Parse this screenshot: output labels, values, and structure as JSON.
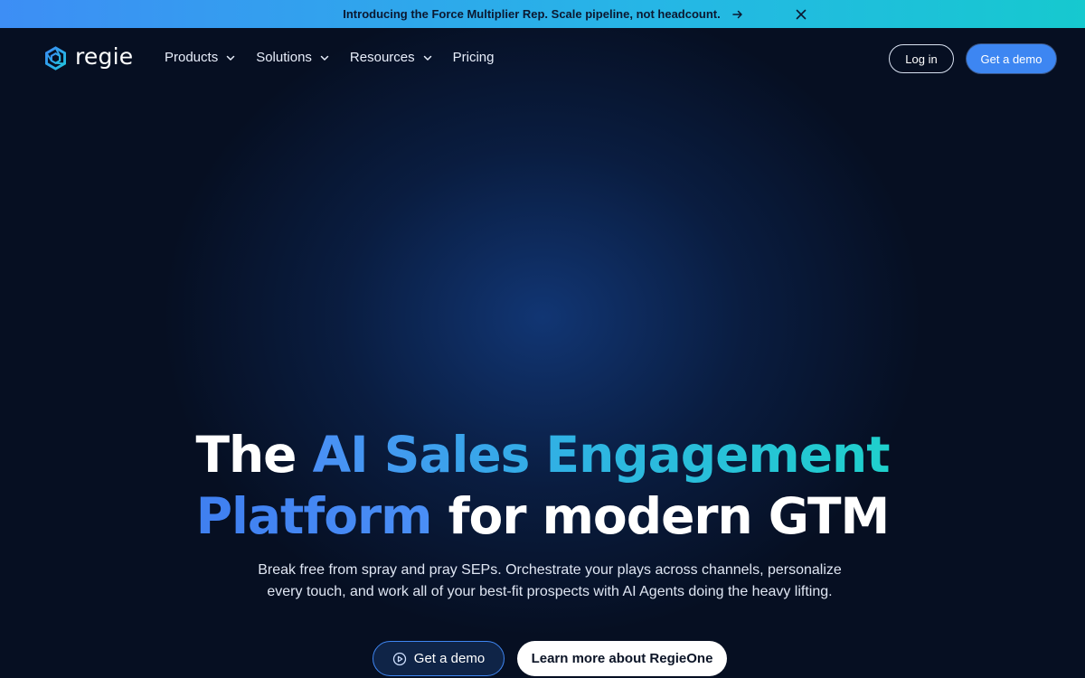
{
  "announcement": {
    "text": "Introducing the Force Multiplier Rep. Scale pipeline, not headcount.",
    "arrow_icon": "arrow-right-icon",
    "close_icon": "close-icon"
  },
  "nav": {
    "logo_text": "regie",
    "menu": [
      {
        "label": "Products",
        "has_dropdown": true
      },
      {
        "label": "Solutions",
        "has_dropdown": true
      },
      {
        "label": "Resources",
        "has_dropdown": true
      },
      {
        "label": "Pricing",
        "has_dropdown": false
      }
    ],
    "login_label": "Log in",
    "demo_label": "Get a demo"
  },
  "hero": {
    "title_part1": "The ",
    "title_gradient1": "AI Sales Engagement",
    "title_gradient2": "Platform",
    "title_part2": " for modern GTM",
    "subtitle": "Break free from spray and pray SEPs. Orchestrate your plays across channels, personalize every touch, and work all of your best-fit prospects with AI Agents doing the heavy lifting.",
    "cta_demo_label": "Get a demo",
    "cta_learn_label": "Learn more about RegieOne"
  },
  "colors": {
    "accent_blue": "#3d86f2",
    "accent_teal": "#1fd0cc",
    "background": "#060f22"
  }
}
